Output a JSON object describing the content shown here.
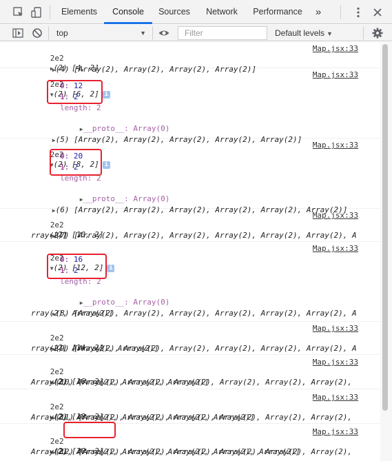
{
  "toolbar": {
    "tabs": [
      "Elements",
      "Console",
      "Sources",
      "Network",
      "Performance"
    ],
    "more": "»",
    "icons": [
      "inspect-icon",
      "device-toggle-icon",
      "kebab-menu-icon",
      "close-icon"
    ]
  },
  "filterbar": {
    "context": "top",
    "filter_placeholder": "Filter",
    "levels": "Default levels"
  },
  "console": {
    "messages": [
      {
        "count": "2e2",
        "summary": "(2) [4, 2]",
        "source": "Map.jsx:33",
        "array_line": "(4) [Array(2), Array(2), Array(2), Array(2)]"
      },
      {
        "count": "2e2",
        "summary": "(2) [6, 2]",
        "source": "Map.jsx:33",
        "entries": [
          "0: 12",
          "1: 2"
        ],
        "length": "length: 2",
        "proto": "__proto__: Array(0)",
        "array_line": "(5) [Array(2), Array(2), Array(2), Array(2), Array(2)]"
      },
      {
        "count": "2e2",
        "summary": "(2) [8, 2]",
        "source": "Map.jsx:33",
        "entries": [
          "0: 20",
          "1: 2"
        ],
        "length": "length: 2",
        "proto": "__proto__: Array(0)",
        "array_line": "(6) [Array(2), Array(2), Array(2), Array(2), Array(2), Array(2)]"
      },
      {
        "count": "2e2",
        "summary": "(2) [10, 2]",
        "source": "Map.jsx:33",
        "array_line": "(7) [Array(2), Array(2), Array(2), Array(2), Array(2), Array(2), A",
        "array_line2": "rray(2)]"
      },
      {
        "count": "2e2",
        "summary": "(2) [12, 2]",
        "source": "Map.jsx:33",
        "entries": [
          "0: 16",
          "1: 2"
        ],
        "length": "length: 2",
        "proto": "__proto__: Array(0)",
        "array_line": "(8) [Array(2), Array(2), Array(2), Array(2), Array(2), Array(2), A",
        "array_line2": "rray(2), Array(2)]"
      },
      {
        "count": "2e2",
        "summary": "(2) [14, 2]",
        "source": "Map.jsx:33",
        "array_line": "(9) [Array(2), Array(2), Array(2), Array(2), Array(2), Array(2), A",
        "array_line2": "rray(2), Array(2), Array(2)]"
      },
      {
        "count": "2e2",
        "summary": "(2) [16, 2]",
        "source": "Map.jsx:33",
        "array_line": "(10) [Array(2), Array(2), Array(2), Array(2), Array(2), Array(2),",
        "array_line2": "Array(2), Array(2), Array(2), Array(2)]"
      },
      {
        "count": "2e2",
        "summary": "(2) [18, 2]",
        "source": "Map.jsx:33",
        "array_line": "(11) [Array(2), Array(2), Array(2), Array(2), Array(2), Array(2),",
        "array_line2": "Array(2), Array(2), Array(2), Array(2), Array(2)]"
      },
      {
        "count": "2e2",
        "summary": "(2) [20, 2]",
        "source": "Map.jsx:33",
        "array_line": "(12) [Array(2), Array(2), Array(2), Array(2), Array(2), Array(2),",
        "array_line2": "Array(2), Array(2), Array(2), Array(2), Array(2), Array(2)]"
      }
    ]
  },
  "colors": {
    "highlight": "#e8202e",
    "active_tab": "#1a73e8",
    "number": "#1a1aa6",
    "key": "#881280"
  }
}
